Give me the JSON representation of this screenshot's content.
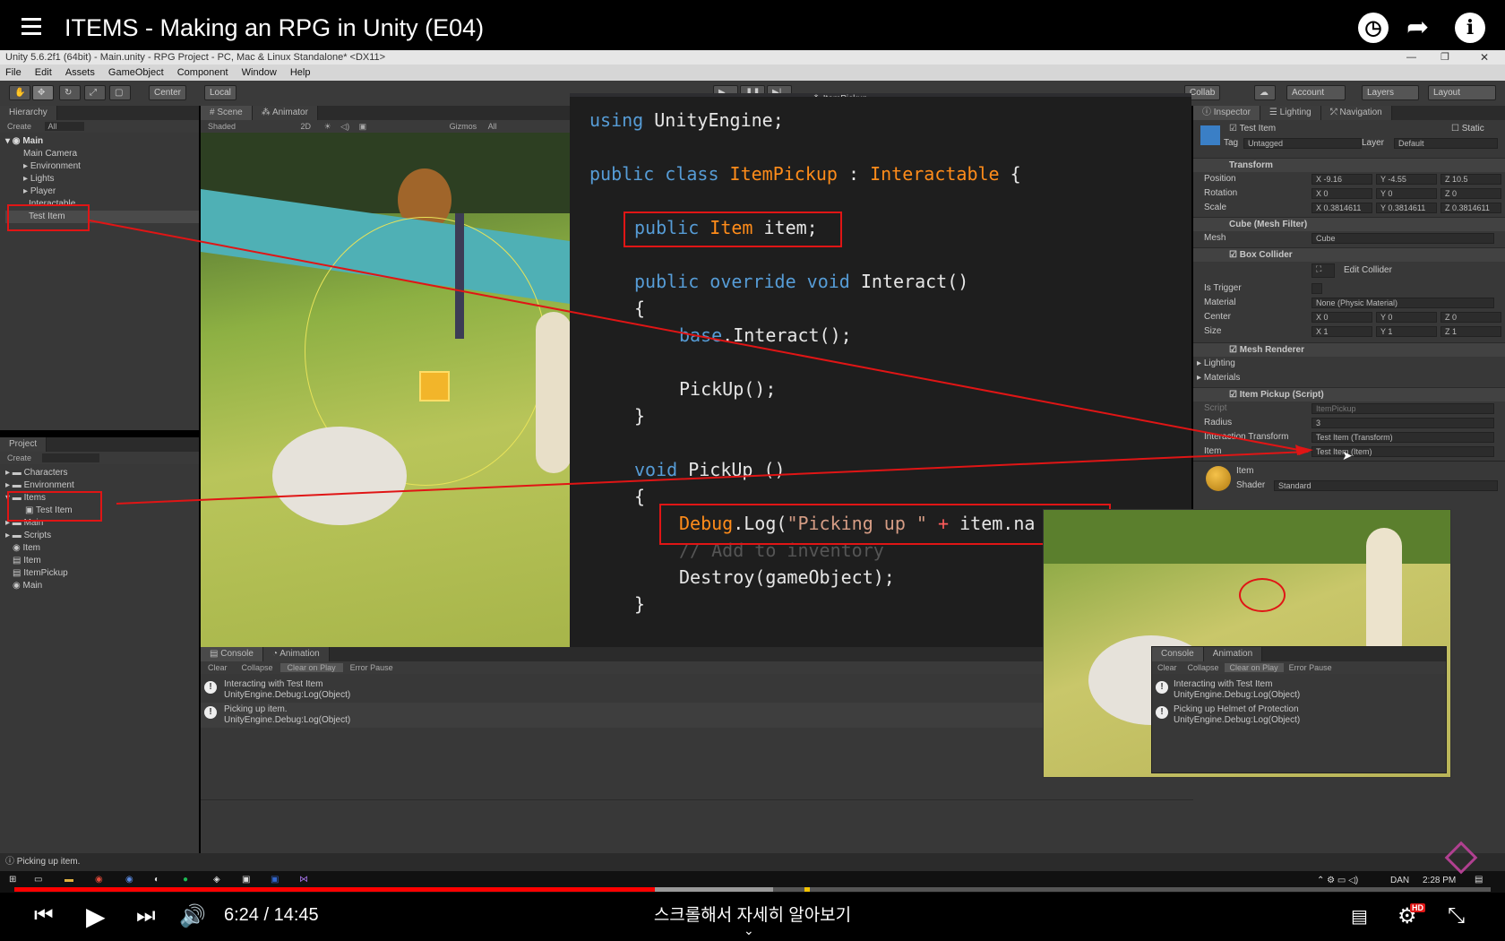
{
  "video": {
    "title": "ITEMS - Making an RPG in Unity (E04)",
    "time": "6:24 / 14:45",
    "caption": "스크롤해서 자세히 알아보기",
    "progress_fraction": 0.434
  },
  "unity": {
    "window_title": "Unity 5.6.2f1 (64bit) - Main.unity - RPG Project - PC, Mac & Linux Standalone* <DX11>",
    "menu": [
      "File",
      "Edit",
      "Assets",
      "GameObject",
      "Component",
      "Window",
      "Help"
    ],
    "toolbar": {
      "center": "Center",
      "local": "Local",
      "collab": "Collab",
      "account": "Account",
      "layers": "Layers",
      "layout": "Layout"
    },
    "hierarchy": {
      "tab": "Hierarchy",
      "create": "Create",
      "search": "All",
      "scene": "Main",
      "items": [
        "Main Camera",
        "Environment",
        "Lights",
        "Player",
        "Interactable",
        "Test Item"
      ]
    },
    "scene_view": {
      "tab_scene": "Scene",
      "tab_animator": "Animator",
      "shaded": "Shaded",
      "mode_2d": "2D",
      "gizmos": "Gizmos",
      "search": "All"
    },
    "project": {
      "tab": "Project",
      "create": "Create",
      "items": [
        "Characters",
        "Environment",
        "Items",
        "Test Item",
        "Main",
        "Scripts",
        "Item",
        "Item",
        "ItemPickup",
        "Main"
      ]
    },
    "editor_tab": "ItemPickup",
    "code": [
      "using UnityEngine;",
      "public class ItemPickup : Interactable {",
      "public Item item;",
      "public override void Interact()",
      "{",
      "base.Interact();",
      "PickUp();",
      "}",
      "void PickUp ()",
      "{",
      "Debug.Log(\"Picking up \" + item.na",
      "// Add to inventory",
      "Destroy(gameObject);",
      "}",
      "}"
    ],
    "inspector": {
      "tabs": [
        "Inspector",
        "Lighting",
        "Navigation"
      ],
      "object_name": "Test Item",
      "static_label": "Static",
      "tag_label": "Tag",
      "tag_value": "Untagged",
      "layer_label": "Layer",
      "layer_value": "Default",
      "transform": {
        "title": "Transform",
        "position_label": "Position",
        "position": [
          "X -9.16",
          "Y -4.55",
          "Z 10.5"
        ],
        "rotation_label": "Rotation",
        "rotation": [
          "X 0",
          "Y 0",
          "Z 0"
        ],
        "scale_label": "Scale",
        "scale": [
          "X 0.3814611",
          "Y 0.3814611",
          "Z 0.3814611"
        ]
      },
      "mesh_filter": {
        "title": "Cube (Mesh Filter)",
        "mesh_label": "Mesh",
        "mesh_value": "Cube"
      },
      "box_collider": {
        "title": "Box Collider",
        "edit": "Edit Collider",
        "is_trigger": "Is Trigger",
        "material_label": "Material",
        "material_value": "None (Physic Material)",
        "center_label": "Center",
        "center": [
          "X 0",
          "Y 0",
          "Z 0"
        ],
        "size_label": "Size",
        "size": [
          "X 1",
          "Y 1",
          "Z 1"
        ]
      },
      "mesh_renderer": {
        "title": "Mesh Renderer",
        "lighting": "Lighting",
        "materials": "Materials"
      },
      "item_pickup": {
        "title": "Item Pickup (Script)",
        "script_label": "Script",
        "script_value": "ItemPickup",
        "radius_label": "Radius",
        "radius_value": "3",
        "interaction_label": "Interaction Transform",
        "interaction_value": "Test Item (Transform)",
        "item_label": "Item",
        "item_value": "Test Item (Item)"
      },
      "material": {
        "name": "Item",
        "shader_label": "Shader",
        "shader_value": "Standard"
      }
    },
    "console": {
      "tabs": [
        "Console",
        "Animation"
      ],
      "buttons": [
        "Clear",
        "Collapse",
        "Clear on Play",
        "Error Pause"
      ],
      "messages": [
        {
          "line1": "Interacting with Test Item",
          "line2": "UnityEngine.Debug:Log(Object)"
        },
        {
          "line1": "Picking up item.",
          "line2": "UnityEngine.Debug:Log(Object)"
        }
      ]
    },
    "inset_console": {
      "tabs": [
        "Console",
        "Animation"
      ],
      "buttons": [
        "Clear",
        "Collapse",
        "Clear on Play",
        "Error Pause"
      ],
      "messages": [
        {
          "line1": "Interacting with Test Item",
          "line2": "UnityEngine.Debug:Log(Object)"
        },
        {
          "line1": "Picking up Helmet of Protection",
          "line2": "UnityEngine.Debug:Log(Object)"
        }
      ]
    },
    "status": "Picking up item."
  },
  "taskbar": {
    "user": "DAN",
    "clock": "2:28 PM"
  }
}
